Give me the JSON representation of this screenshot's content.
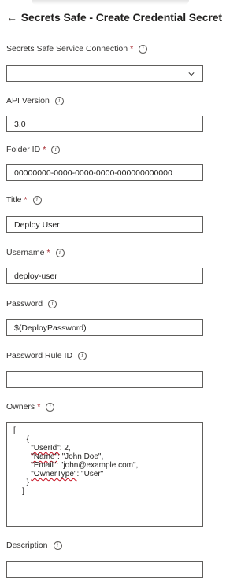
{
  "header": {
    "back_icon": "←",
    "title": "Secrets Safe - Create Credential Secret"
  },
  "fields": {
    "connection": {
      "label": "Secrets Safe Service Connection",
      "required_mark": "*",
      "value": ""
    },
    "api_version": {
      "label": "API Version",
      "value": "3.0"
    },
    "folder_id": {
      "label": "Folder ID",
      "required_mark": "*",
      "value": "00000000-0000-0000-0000-000000000000"
    },
    "title": {
      "label": "Title",
      "required_mark": "*",
      "value": "Deploy User"
    },
    "username": {
      "label": "Username",
      "required_mark": "*",
      "value": "deploy-user"
    },
    "password": {
      "label": "Password",
      "value": "$(DeployPassword)"
    },
    "password_rule_id": {
      "label": "Password Rule ID",
      "value": ""
    },
    "owners": {
      "label": "Owners",
      "required_mark": "*",
      "lines": {
        "open_bracket": "[",
        "open_brace": "{",
        "userid_key": "\"UserId\"",
        "userid_rest": ": 2,",
        "name_key": "\"Name\"",
        "name_rest": ": \"John Doe\",",
        "email_line": "\"Email\": \"john@example.com\",",
        "ownertype_key": "\"OwnerType\"",
        "ownertype_rest": ": \"User\"",
        "close_brace": "}",
        "close_bracket": "]"
      }
    },
    "description": {
      "label": "Description",
      "value": ""
    }
  },
  "icons": {
    "info": "info-icon",
    "dropdown": "chevron-down-icon"
  },
  "colors": {
    "required": "#a4262c",
    "border": "#605e5c",
    "spellcheck": "#c50f1f"
  }
}
